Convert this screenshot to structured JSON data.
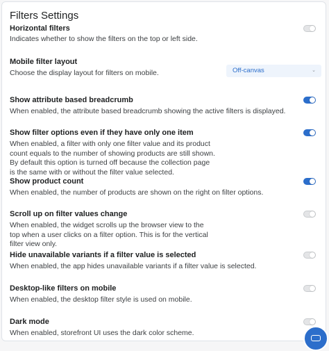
{
  "page": {
    "title": "Filters Settings"
  },
  "select_mobile_layout": {
    "value": "Off-canvas"
  },
  "settings": [
    {
      "title": "Horizontal filters",
      "description": "Indicates whether to show the filters on the top or left side.",
      "enabled": false
    },
    {
      "title": "Mobile filter layout",
      "description": "Choose the display layout for filters on mobile."
    },
    {
      "title": "Show attribute based breadcrumb",
      "description": "When enabled, the attribute based breadcrumb showing the active filters is displayed.",
      "enabled": true
    },
    {
      "title": "Show filter options even if they have only one item",
      "description": "When enabled, a filter with only one filter value and its product count equals to the number of showing products are still shown. By default this option is turned off because the collection page is the same with or without the filter value selected.",
      "enabled": true
    },
    {
      "title": "Show product count",
      "description": "When enabled, the number of products are shown on the right on filter options.",
      "enabled": true
    },
    {
      "title": "Scroll up on filter values change",
      "description": "When enabled, the widget scrolls up the browser view to the top when a user clicks on a filter option. This is for the vertical filter view only.",
      "enabled": false
    },
    {
      "title": "Hide unavailable variants if a filter value is selected",
      "description": "When enabled, the app hides unavailable variants if a filter value is selected.",
      "enabled": false
    },
    {
      "title": "Desktop-like filters on mobile",
      "description": "When enabled, the desktop filter style is used on mobile.",
      "enabled": false
    },
    {
      "title": "Dark mode",
      "description": "When enabled, storefront UI uses the dark color scheme.",
      "enabled": false
    }
  ],
  "colors": {
    "accent": "#2c6ecb",
    "toggle_off": "#e4e5e7"
  }
}
